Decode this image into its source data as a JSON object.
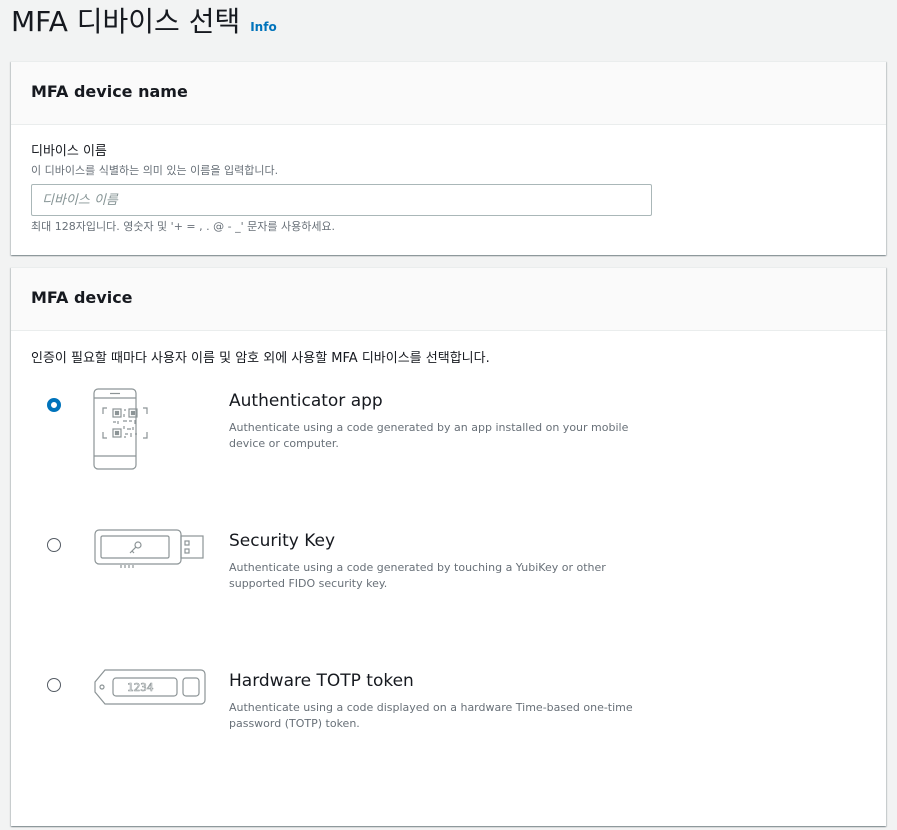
{
  "header": {
    "title": "MFA 디바이스 선택",
    "info_link": "Info"
  },
  "name_panel": {
    "title": "MFA device name",
    "label": "디바이스 이름",
    "description": "이 디바이스를 식별하는 의미 있는 이름을 입력합니다.",
    "placeholder": "디바이스 이름",
    "value": "",
    "constraint": "최대 128자입니다. 영숫자 및 '+ = , . @ - _' 문자를 사용하세요."
  },
  "device_panel": {
    "title": "MFA device",
    "intro": "인증이 필요할 때마다 사용자 이름 및 암호 외에 사용할 MFA 디바이스를 선택합니다.",
    "selected": "authenticator",
    "options": [
      {
        "id": "authenticator",
        "title": "Authenticator app",
        "description": "Authenticate using a code generated by an app installed on your mobile device or computer.",
        "icon": "phone-qr-code-icon"
      },
      {
        "id": "security_key",
        "title": "Security Key",
        "description": "Authenticate using a code generated by touching a YubiKey or other supported FIDO security key.",
        "icon": "usb-security-key-icon"
      },
      {
        "id": "totp",
        "title": "Hardware TOTP token",
        "description": "Authenticate using a code displayed on a hardware Time-based one-time password (TOTP) token.",
        "icon": "hardware-token-icon",
        "token_display": "1234"
      }
    ]
  },
  "colors": {
    "accent": "#0073bb",
    "page_bg": "#f2f3f3",
    "icon_stroke": "#8c9496"
  }
}
